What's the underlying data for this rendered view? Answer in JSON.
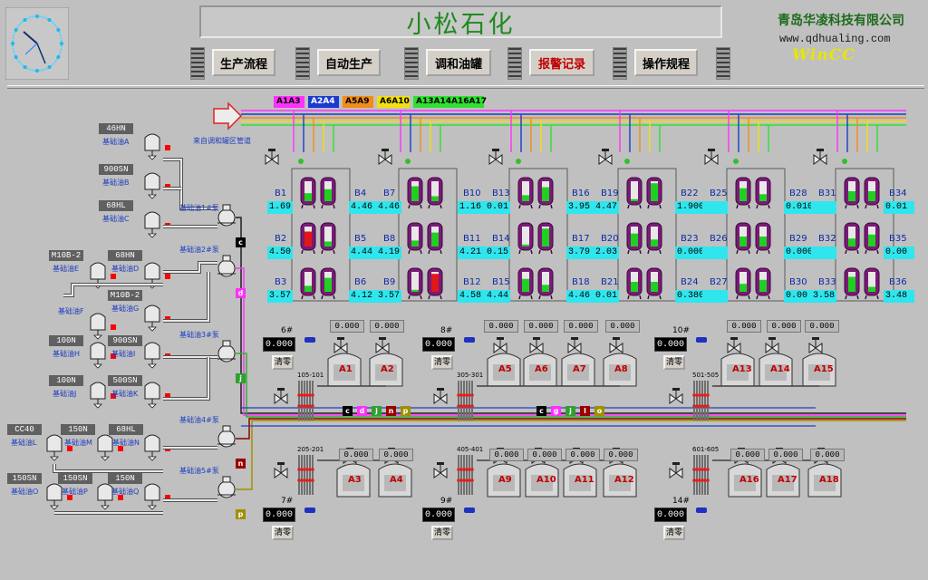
{
  "header": {
    "title": "小松石化",
    "company": "青岛华凌科技有限公司",
    "website": "www.qdhualing.com",
    "logo": "WinCC",
    "nav": [
      "生产流程",
      "自动生产",
      "调和油罐",
      "报警记录",
      "操作规程"
    ]
  },
  "legend": [
    {
      "label": "A1A3",
      "color": "#ff30ff"
    },
    {
      "label": "A2A4",
      "color": "#1a3bd0"
    },
    {
      "label": "A5A9",
      "color": "#f08c1a"
    },
    {
      "label": "A6A10",
      "color": "#f0e010"
    },
    {
      "label": "A13A14A16A17",
      "color": "#30e030"
    }
  ],
  "source_label": "来自调和罐区管道",
  "sources": [
    {
      "box": "46HN",
      "name": "基础油A"
    },
    {
      "box": "900SN",
      "name": "基础油B"
    },
    {
      "box": "68HL",
      "name": "基础油C"
    },
    {
      "box": "M10B-2",
      "name": "基础油E"
    },
    {
      "box": "68HN",
      "name": "基础油D"
    },
    {
      "box": "M10B-2",
      "name": "基础油G"
    },
    {
      "box": "",
      "name": "基础油F"
    },
    {
      "box": "100N",
      "name": "基础油H"
    },
    {
      "box": "900SN",
      "name": "基础油I"
    },
    {
      "box": "100N",
      "name": "基础油J"
    },
    {
      "box": "500SN",
      "name": "基础油K"
    },
    {
      "box": "CC40",
      "name": "基础油L"
    },
    {
      "box": "150N",
      "name": "基础油M"
    },
    {
      "box": "68HL",
      "name": "基础油N"
    },
    {
      "box": "150SN",
      "name": "基础油O"
    },
    {
      "box": "150SN",
      "name": "基础油P"
    },
    {
      "box": "150N",
      "name": "基础油Q"
    }
  ],
  "pumps": [
    {
      "name": "基础油1#泵",
      "tag": "c"
    },
    {
      "name": "基础油2#泵",
      "tag": "d"
    },
    {
      "name": "基础油3#泵",
      "tag": "j"
    },
    {
      "name": "基础油4#泵",
      "tag": "n"
    },
    {
      "name": "基础油5#泵",
      "tag": "p"
    }
  ],
  "b_tanks": [
    {
      "label": "B1",
      "value": "1.69"
    },
    {
      "label": "B2",
      "value": "4.50"
    },
    {
      "label": "B3",
      "value": "3.57"
    },
    {
      "label": "B4",
      "value": "4.46"
    },
    {
      "label": "B5",
      "value": "4.44"
    },
    {
      "label": "B6",
      "value": "4.12"
    },
    {
      "label": "B7",
      "value": "4.46"
    },
    {
      "label": "B8",
      "value": "4.19"
    },
    {
      "label": "B9",
      "value": "3.57"
    },
    {
      "label": "B10",
      "value": "1.16"
    },
    {
      "label": "B11",
      "value": "4.21"
    },
    {
      "label": "B12",
      "value": "4.58"
    },
    {
      "label": "B13",
      "value": "0.01"
    },
    {
      "label": "B14",
      "value": "0.15"
    },
    {
      "label": "B15",
      "value": "4.44"
    },
    {
      "label": "B16",
      "value": "3.95"
    },
    {
      "label": "B17",
      "value": "3.79"
    },
    {
      "label": "B18",
      "value": "4.46"
    },
    {
      "label": "B19",
      "value": "4.47"
    },
    {
      "label": "B20",
      "value": "2.03"
    },
    {
      "label": "B21",
      "value": "0.01"
    },
    {
      "label": "B22",
      "value": "1.900.00"
    },
    {
      "label": "B23",
      "value": "0.000.01"
    },
    {
      "label": "B24",
      "value": "0.380.00"
    },
    {
      "label": "B25",
      "value": ""
    },
    {
      "label": "B26",
      "value": ""
    },
    {
      "label": "B27",
      "value": ""
    },
    {
      "label": "B28",
      "value": "0.010.00"
    },
    {
      "label": "B29",
      "value": "0.000.00"
    },
    {
      "label": "B30",
      "value": "0.00"
    },
    {
      "label": "B31",
      "value": ""
    },
    {
      "label": "B32",
      "value": ""
    },
    {
      "label": "B33",
      "value": "3.58"
    },
    {
      "label": "B34",
      "value": "0.01"
    },
    {
      "label": "B35",
      "value": "0.00"
    },
    {
      "label": "B36",
      "value": "3.48"
    }
  ],
  "stations": [
    {
      "num": "6#",
      "value": "0.000",
      "reset": "清零",
      "manifold": "105-101",
      "tops": [
        "0.000",
        "0.000"
      ],
      "tanks": [
        "A1",
        "A2"
      ]
    },
    {
      "num": "8#",
      "value": "0.000",
      "reset": "清零",
      "manifold": "305-301",
      "tops": [
        "0.000",
        "0.000",
        "0.000",
        "0.000"
      ],
      "tanks": [
        "A5",
        "A6",
        "A7",
        "A8"
      ]
    },
    {
      "num": "10#",
      "value": "0.000",
      "reset": "清零",
      "manifold": "501-505",
      "tops": [
        "0.000",
        "0.000",
        "0.000"
      ],
      "tanks": [
        "A13",
        "A14",
        "A15"
      ]
    },
    {
      "num": "7#",
      "value": "0.000",
      "reset": "清零",
      "manifold": "205-201",
      "tops": [
        "0.000",
        "0.000"
      ],
      "tanks": [
        "A3",
        "A4"
      ]
    },
    {
      "num": "9#",
      "value": "0.000",
      "reset": "清零",
      "manifold": "405-401",
      "tops": [
        "0.000",
        "0.000",
        "0.000",
        "0.000"
      ],
      "tanks": [
        "A9",
        "A10",
        "A11",
        "A12"
      ]
    },
    {
      "num": "14#",
      "value": "0.000",
      "reset": "清零",
      "manifold": "601-605",
      "tops": [
        "0.000",
        "0.000",
        "0.000"
      ],
      "tanks": [
        "A16",
        "A17",
        "A18"
      ]
    }
  ],
  "line_tags": [
    {
      "tags": [
        "c",
        "d",
        "j",
        "n",
        "p"
      ]
    },
    {
      "tags": [
        "c",
        "g",
        "j",
        "l",
        "o"
      ]
    }
  ],
  "colors": {
    "background": "#c0c0c0",
    "title": "#1f8a1f",
    "value_cyan": "#2fe6ee",
    "tank_purple": "#7a1a78",
    "level_green": "#20d020",
    "level_red": "#e01818",
    "alarm": "#ff0000"
  },
  "icons": [
    "analog-clock-icon",
    "arrow-right-icon",
    "valve-icon",
    "pump-icon",
    "tank-icon"
  ]
}
